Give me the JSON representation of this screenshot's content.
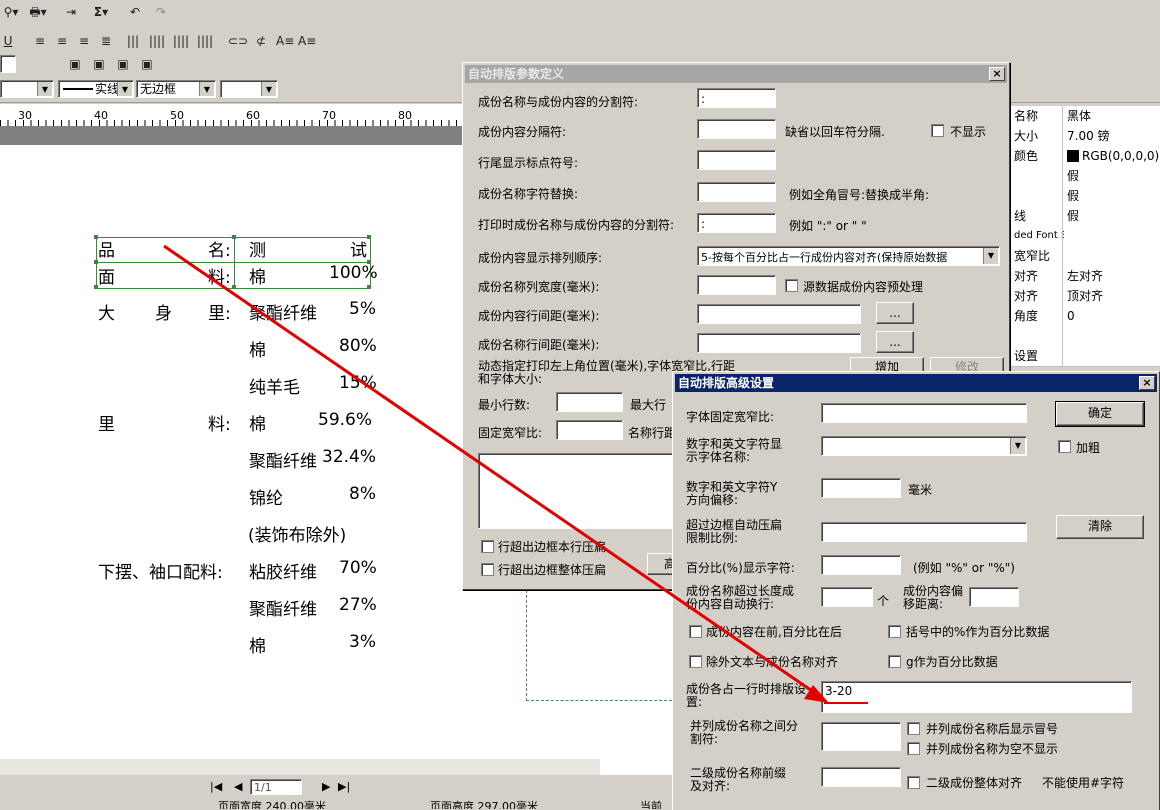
{
  "toolbar": {
    "row1": [
      "⚲▾",
      "🖶▾",
      "⇥",
      "Σ▾",
      "↶",
      "↷"
    ],
    "row2_underline": "U",
    "line_style": "实线",
    "border_style": "无边框"
  },
  "ruler": {
    "ticks": [
      "30",
      "40",
      "50",
      "60",
      "70",
      "80"
    ]
  },
  "document": {
    "rows": [
      {
        "label": "品",
        "label2": "名:",
        "value": "测",
        "value2": "试"
      },
      {
        "label": "面",
        "label2": "料:",
        "value": "棉",
        "value2": "100%"
      },
      {
        "label": "大",
        "label_mid": "身",
        "label2": "里:",
        "value": "聚酯纤维",
        "value2": "5%"
      },
      {
        "value": "棉",
        "value2": "80%"
      },
      {
        "value": "纯羊毛",
        "value2": "15%"
      },
      {
        "label": "里",
        "label2": "料:",
        "value": "棉",
        "value2": "59.6%"
      },
      {
        "value": "聚酯纤维",
        "value2": "32.4%"
      },
      {
        "value": "锦纶",
        "value2": "8%"
      },
      {
        "value": "(装饰布除外)"
      },
      {
        "label": "下摆、袖口配料:",
        "value": "粘胶纤维",
        "value2": "70%"
      },
      {
        "value": "聚酯纤维",
        "value2": "27%"
      },
      {
        "value": "棉",
        "value2": "3%"
      }
    ]
  },
  "properties": {
    "rows": [
      {
        "k": "名称",
        "v": "黑体"
      },
      {
        "k": "大小",
        "v": "7.00 镑"
      },
      {
        "k": "颜色",
        "v": "RGB(0,0,0,0)"
      },
      {
        "k": "",
        "v": "假"
      },
      {
        "k": "",
        "v": "假"
      },
      {
        "k": "线",
        "v": "假"
      },
      {
        "k": "ded Font S",
        "v": ""
      },
      {
        "k": "宽窄比",
        "v": ""
      },
      {
        "k": "对齐",
        "v": "左对齐"
      },
      {
        "k": "对齐",
        "v": "顶对齐"
      },
      {
        "k": "角度",
        "v": "0"
      },
      {
        "k": "",
        "v": ""
      },
      {
        "k": "设置",
        "v": ""
      },
      {
        "k": "",
        "v": ""
      }
    ]
  },
  "dialog1": {
    "title": "自动排版参数定义",
    "fields": {
      "sep_label": "成份名称与成份内容的分割符:",
      "sep_value": ":",
      "content_sep_label": "成份内容分隔符:",
      "content_sep_hint": "缺省以回车符分隔.",
      "hide_label": "不显示",
      "tail_label": "行尾显示标点符号:",
      "replace_label": "成份名称字符替换:",
      "replace_hint": "例如全角冒号:替换成半角:",
      "print_sep_label": "打印时成份名称与成份内容的分割符:",
      "print_sep_value": ":",
      "print_sep_hint": "例如 \":\" or \" \"",
      "order_label": "成份内容显示排列顺序:",
      "order_value": "5-按每个百分比占一行成份内容对齐(保持原始数据",
      "col_width_label": "成份名称列宽度(毫米):",
      "preprocess_label": "源数据成份内容预处理",
      "content_spacing_label": "成份内容行间距(毫米):",
      "name_spacing_label": "成份名称行间距(毫米):",
      "ellipsis": "...",
      "dynamic_label": "动态指定打印左上角位置(毫米),字体宽窄比,行距和字体大小:",
      "add_btn": "增加",
      "edit_btn": "修改",
      "min_rows_label": "最小行数:",
      "max_rows_label": "最大行",
      "fixed_ratio_label": "固定宽窄比:",
      "name_row_label": "名称行距",
      "compress_row_label": "行超出边框本行压扁",
      "compress_all_label": "行超出边框整体压扁",
      "adv_btn_partial": "高"
    }
  },
  "dialog2": {
    "title": "自动排版高级设置",
    "fields": {
      "font_ratio_label": "字体固定宽窄比:",
      "ok_btn": "确定",
      "digit_font_label": "数字和英文字符显示字体名称:",
      "bold_label": "加粗",
      "y_offset_label": "数字和英文字符Y方向偏移:",
      "mm_unit": "毫米",
      "auto_compress_label": "超过边框自动压扁限制比例:",
      "clear_btn": "清除",
      "percent_label": "百分比(%)显示字符:",
      "percent_hint": "(例如 \"%\" or \"%\")",
      "wrap_label": "成份名称超过长度成份内容自动换行:",
      "count_unit": "个",
      "offset_label": "成份内容偏移距离:",
      "content_first_label": "成份内容在前,百分比在后",
      "bracket_label": "括号中的%作为百分比数据",
      "align_other_label": "除外文本与成份名称对齐",
      "g_label": "g作为百分比数据",
      "row_setting_label": "成份各占一行时排版设置:",
      "row_setting_value": "3-20",
      "parallel_sep_label": "并列成份名称之间分割符:",
      "parallel_colon_label": "并列成份名称后显示冒号",
      "parallel_empty_label": "并列成份名称为空不显示",
      "second_level_label": "二级成份名称前缀及对齐:",
      "second_align_label": "二级成份整体对齐",
      "no_hash_label": "不能使用#字符"
    }
  },
  "statusbar": {
    "page": "1/1",
    "seg1": "页面宽度 240.00毫米",
    "seg2": "页面高度 297.00毫米",
    "seg3": "当前"
  },
  "colors": {
    "arrow": "#e00000",
    "titlebar": "#0a246a"
  }
}
